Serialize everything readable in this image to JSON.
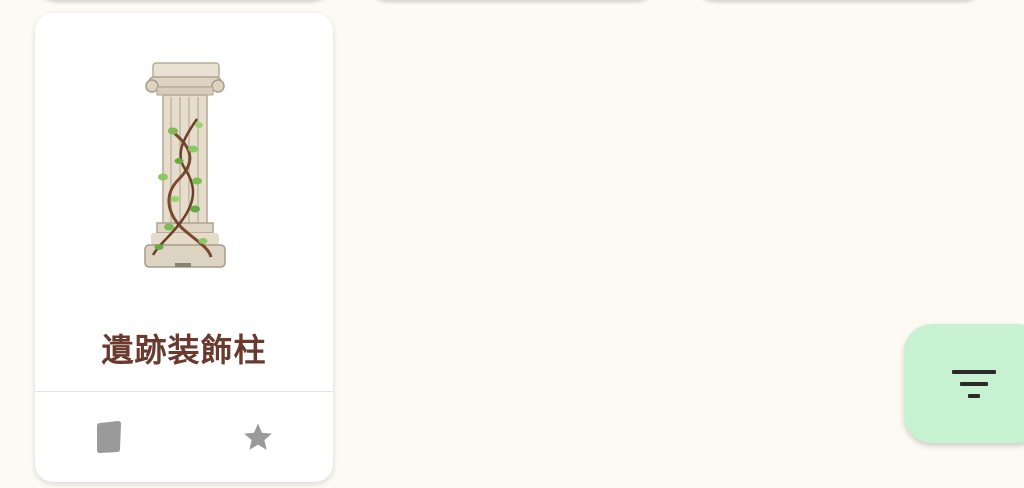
{
  "item_card": {
    "name": "遺跡装飾柱",
    "image_icon": "ruin-column-with-vines",
    "actions": [
      {
        "icon": "card-icon"
      },
      {
        "icon": "star-icon"
      }
    ]
  },
  "filter_button": {
    "icon": "filter-icon"
  },
  "colors": {
    "background": "#fdf9f3",
    "card": "#ffffff",
    "title": "#6b3a2e",
    "action_icon": "#9a9a9a",
    "fab": "#c7f2d2",
    "fab_icon": "#2a2a2a"
  }
}
